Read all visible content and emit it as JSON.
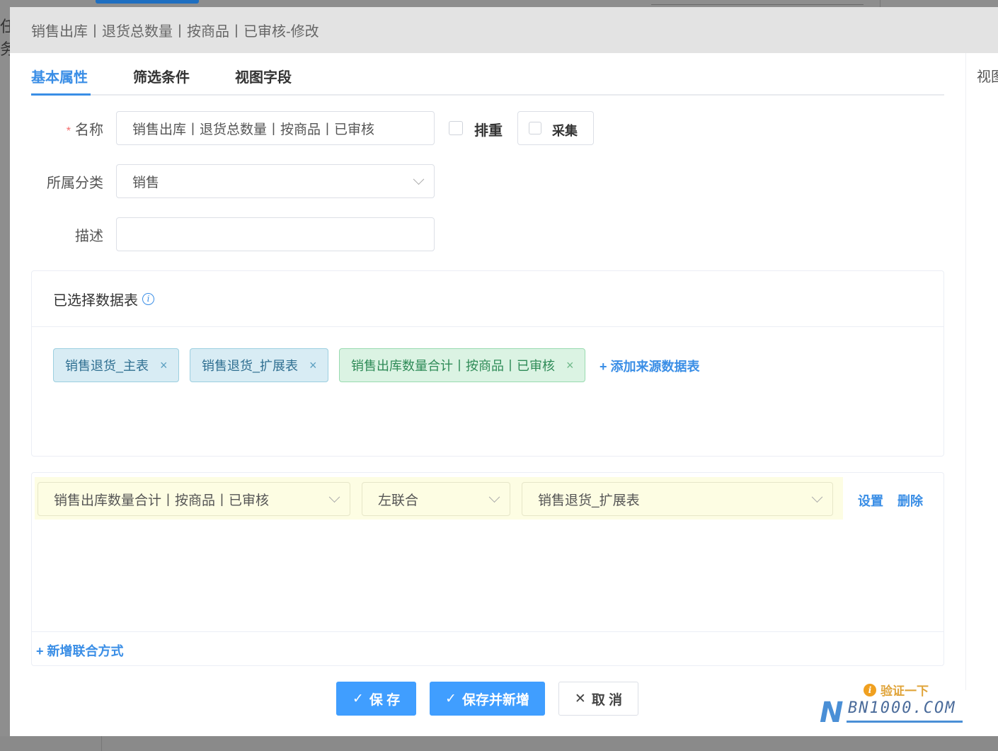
{
  "background": {
    "left_fragment": "任务"
  },
  "modal": {
    "title": "销售出库丨退货总数量丨按商品丨已审核-修改",
    "tabs": [
      {
        "label": "基本属性",
        "active": true
      },
      {
        "label": "筛选条件",
        "active": false
      },
      {
        "label": "视图字段",
        "active": false
      }
    ],
    "side_tab": "视图"
  },
  "form": {
    "name_required_mark": "*",
    "name_label": "名称",
    "name_value": "销售出库丨退货总数量丨按商品丨已审核",
    "dedupe_label": "排重",
    "dedupe_checked": false,
    "collect_label": "采集",
    "collect_checked": false,
    "category_label": "所属分类",
    "category_value": "销售",
    "description_label": "描述",
    "description_value": ""
  },
  "tables_panel": {
    "title": "已选择数据表",
    "info_icon": "info-icon",
    "tags": [
      {
        "label": "销售退货_主表",
        "color": "blue"
      },
      {
        "label": "销售退货_扩展表",
        "color": "blue"
      },
      {
        "label": "销售出库数量合计丨按商品丨已审核",
        "color": "green"
      }
    ],
    "close_glyph": "×",
    "add_link": "+ 添加来源数据表"
  },
  "join_panel": {
    "row": {
      "left_table": "销售出库数量合计丨按商品丨已审核",
      "join_type": "左联合",
      "right_table": "销售退货_扩展表",
      "settings_link": "设置",
      "delete_link": "删除"
    },
    "add_link": "+ 新增联合方式"
  },
  "buttons": {
    "save": "保 存",
    "save_and_new": "保存并新增",
    "cancel": "取 消",
    "check_glyph": "✓",
    "cancel_glyph": "✕"
  },
  "watermark": {
    "verify_text": "验证一下",
    "brand_letter": "N",
    "brand_text": "BN1000.COM"
  },
  "colors": {
    "accent": "#3a8ee6",
    "primary_button": "#409eff",
    "required": "#f56c6c",
    "join_row_highlight": "#fdfde3",
    "tag_blue_bg": "#d8ecf4",
    "tag_green_bg": "#dbf3e3"
  }
}
